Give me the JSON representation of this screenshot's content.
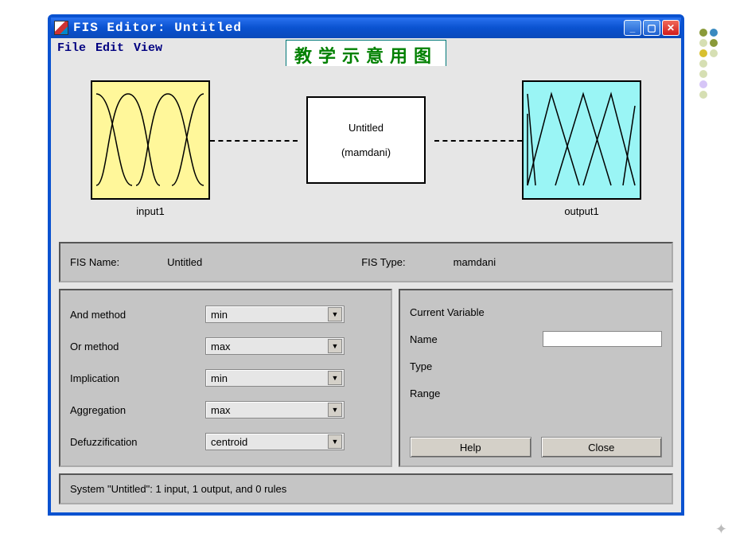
{
  "window": {
    "title": "FIS Editor: Untitled"
  },
  "menu": {
    "file": "File",
    "edit": "Edit",
    "view": "View"
  },
  "overlay": "教学示意用图",
  "diagram": {
    "input_label": "input1",
    "output_label": "output1",
    "rule_name": "Untitled",
    "rule_type": "(mamdani)"
  },
  "info": {
    "fis_name_label": "FIS Name:",
    "fis_name_value": "Untitled",
    "fis_type_label": "FIS Type:",
    "fis_type_value": "mamdani"
  },
  "methods": {
    "and_label": "And method",
    "and_value": "min",
    "or_label": "Or method",
    "or_value": "max",
    "imp_label": "Implication",
    "imp_value": "min",
    "agg_label": "Aggregation",
    "agg_value": "max",
    "defuzz_label": "Defuzzification",
    "defuzz_value": "centroid"
  },
  "variable": {
    "header": "Current Variable",
    "name_label": "Name",
    "name_value": "",
    "type_label": "Type",
    "range_label": "Range"
  },
  "buttons": {
    "help": "Help",
    "close": "Close"
  },
  "status": "System \"Untitled\": 1 input, 1 output, and 0 rules"
}
